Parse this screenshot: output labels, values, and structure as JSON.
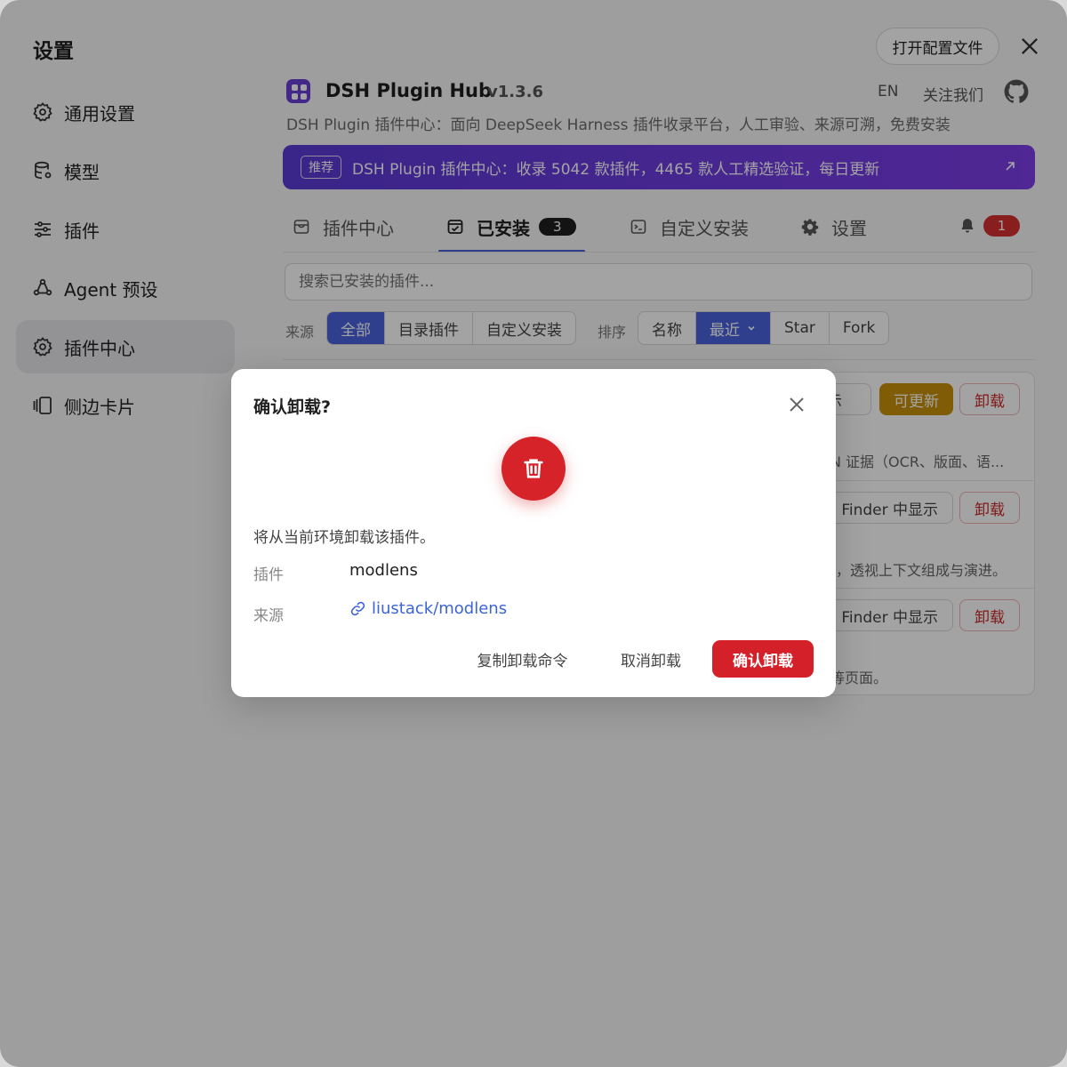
{
  "sidebar": {
    "title": "设置",
    "items": [
      {
        "label": "通用设置",
        "icon": "gear-icon"
      },
      {
        "label": "模型",
        "icon": "database-icon"
      },
      {
        "label": "插件",
        "icon": "sliders-icon"
      },
      {
        "label": "Agent 预设",
        "icon": "agent-icon"
      },
      {
        "label": "插件中心",
        "icon": "gear-icon",
        "active": true
      },
      {
        "label": "侧边卡片",
        "icon": "cards-icon"
      }
    ]
  },
  "topbar": {
    "open_config": "打开配置文件"
  },
  "hub": {
    "name": "DSH Plugin Hub",
    "version": "v1.3.6",
    "lang": "EN",
    "follow": "关注我们",
    "description": "DSH Plugin 插件中心：面向 DeepSeek Harness 插件收录平台，人工审验、来源可溯，免费安装",
    "brand_color": "#6a3fd6"
  },
  "banner": {
    "badge": "推荐",
    "text": "DSH Plugin 插件中心：收录 5042 款插件，4465 款人工精选验证，每日更新"
  },
  "tabs": [
    {
      "label": "插件中心",
      "icon": "store-icon"
    },
    {
      "label": "已安装",
      "icon": "installed-icon",
      "count": "3",
      "active": true
    },
    {
      "label": "自定义安装",
      "icon": "terminal-icon"
    },
    {
      "label": "设置",
      "icon": "gear-icon"
    }
  ],
  "notifications": {
    "count": "1"
  },
  "search": {
    "placeholder": "搜索已安装的插件..."
  },
  "filters": {
    "source_label": "来源",
    "source_options": [
      "全部",
      "目录插件",
      "自定义安装"
    ],
    "source_selected": "全部",
    "sort_label": "排序",
    "sort_options": [
      "名称",
      "最近",
      "Star",
      "Fork"
    ],
    "sort_selected": "最近"
  },
  "rows": [
    {
      "finder": "显示",
      "update": "可更新",
      "uninstall": "卸载",
      "desc": "N 证据（OCR、版面、语..."
    },
    {
      "finder": "Finder 中显示",
      "uninstall": "卸载",
      "desc": "，透视上下文组成与演进。"
    },
    {
      "finder": "Finder 中显示",
      "uninstall": "卸载",
      "desc": "等页面。"
    }
  ],
  "dialog": {
    "title": "确认卸载?",
    "message": "将从当前环境卸载该插件。",
    "plugin_label": "插件",
    "plugin_value": "modlens",
    "source_label": "来源",
    "source_value": "liustack/modlens",
    "copy_cmd": "复制卸载命令",
    "cancel": "取消卸载",
    "confirm": "确认卸载",
    "danger_color": "#d42029"
  }
}
